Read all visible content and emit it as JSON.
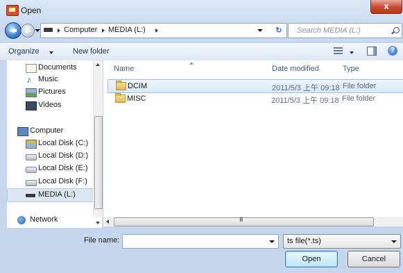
{
  "window": {
    "title": "Open",
    "close_label": "x"
  },
  "address": {
    "crumbs": [
      "Computer",
      "MEDIA (L:)"
    ],
    "refresh_label": "↻",
    "search_placeholder": "Search MEDIA (L:)"
  },
  "toolbar": {
    "organize_label": "Organize",
    "new_folder_label": "New folder",
    "help_label": "?"
  },
  "nav": {
    "items": [
      {
        "label": "Documents",
        "icon": "documents-icon"
      },
      {
        "label": "Music",
        "icon": "music-icon"
      },
      {
        "label": "Pictures",
        "icon": "pictures-icon"
      },
      {
        "label": "Videos",
        "icon": "videos-icon"
      },
      {
        "label": "Computer",
        "icon": "computer-icon"
      },
      {
        "label": "Local Disk (C:)",
        "icon": "system-disk-icon"
      },
      {
        "label": "Local Disk (D:)",
        "icon": "disk-icon"
      },
      {
        "label": "Local Disk (E:)",
        "icon": "disk-icon"
      },
      {
        "label": "Local Disk (F:)",
        "icon": "disk-icon"
      },
      {
        "label": "MEDIA (L:)",
        "icon": "removable-drive-icon",
        "selected": true
      },
      {
        "label": "Network",
        "icon": "network-icon"
      }
    ]
  },
  "files": {
    "columns": [
      "Name",
      "Date modified",
      "Type"
    ],
    "rows": [
      {
        "name": "DCIM",
        "date": "2011/5/3 上午 09:18",
        "type": "File folder",
        "selected": true
      },
      {
        "name": "MISC",
        "date": "2011/5/3 上午 09:18",
        "type": "File folder",
        "selected": false
      }
    ]
  },
  "scroll": {
    "grip": "III"
  },
  "footer": {
    "file_name_label": "File name:",
    "file_name_value": "",
    "file_type_value": "ts file(*.ts)",
    "open_label": "Open",
    "cancel_label": "Cancel"
  }
}
